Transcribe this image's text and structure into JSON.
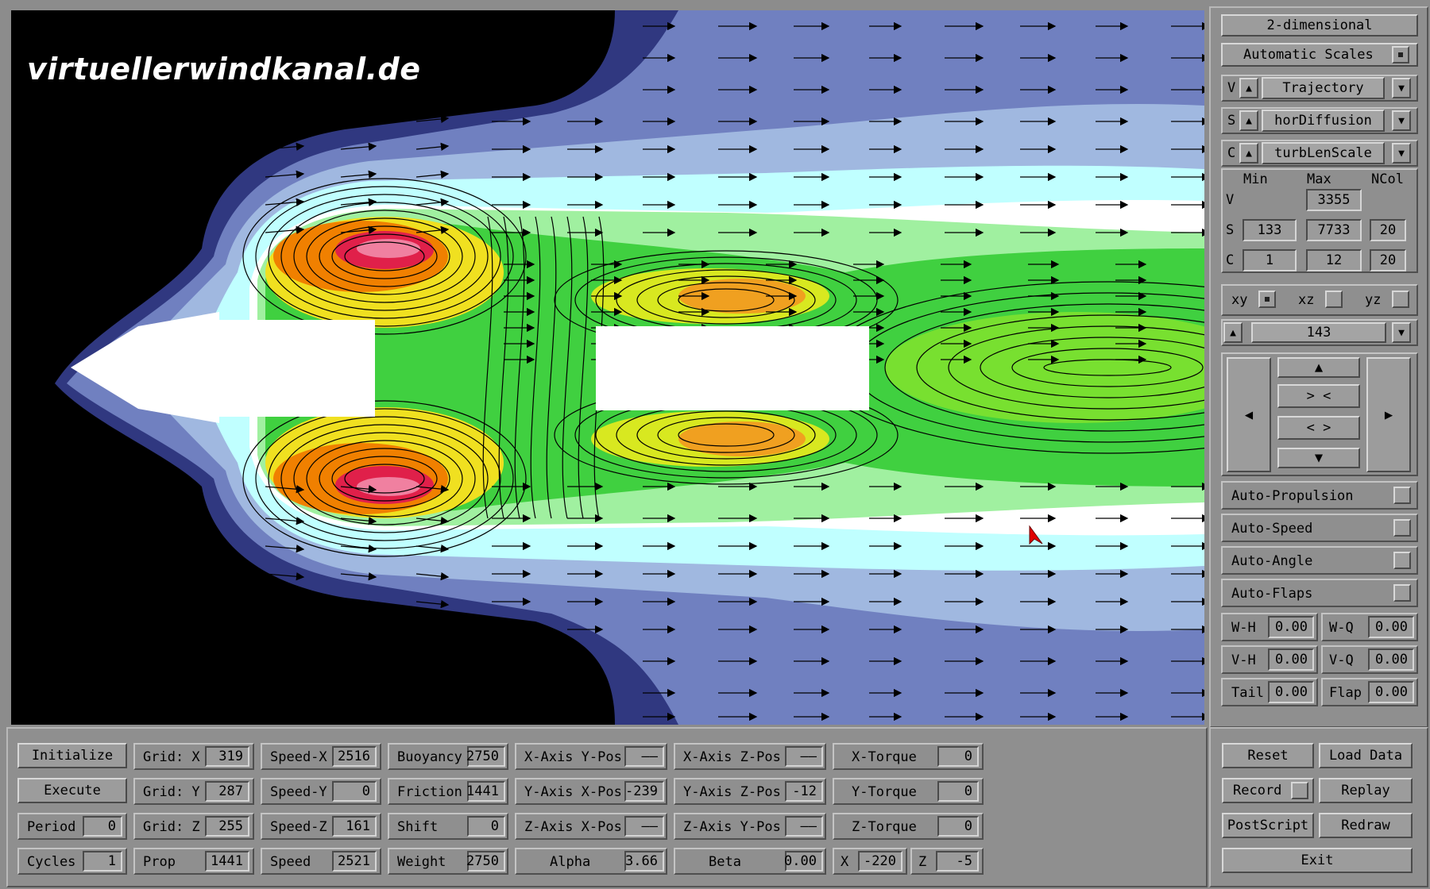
{
  "watermark": "virtuellerwindkanal.de",
  "colors": {
    "panel": "#8f8f8f",
    "red": "#e0204a",
    "orange": "#f08000",
    "yellow": "#f0e020",
    "green": "#40d040",
    "lightgreen": "#a0f0a0",
    "cyan": "#c0ffff",
    "lightblue": "#a0b8e0",
    "blue": "#7080c0",
    "navy": "#303880"
  },
  "side": {
    "mode": "2-dimensional",
    "automatic_scales": "Automatic Scales",
    "rows": [
      {
        "letter": "V",
        "value": "Trajectory"
      },
      {
        "letter": "S",
        "value": "horDiffusion"
      },
      {
        "letter": "C",
        "value": "turbLenScale"
      }
    ],
    "headers": {
      "min": "Min",
      "max": "Max",
      "ncol": "NCol"
    },
    "scales": [
      {
        "letter": "V",
        "min": "",
        "max": "3355",
        "ncol": ""
      },
      {
        "letter": "S",
        "min": "133",
        "max": "7733",
        "ncol": "20"
      },
      {
        "letter": "C",
        "min": "1",
        "max": "12",
        "ncol": "20"
      }
    ],
    "planes": [
      "xy",
      "xz",
      "yz"
    ],
    "slice": "143",
    "nav": {
      "up": "▲",
      "down": "▼",
      "left": "◀",
      "right": "▶",
      "zoom_in": "> <",
      "zoom_out": "< >"
    },
    "autos": [
      "Auto-Propulsion",
      "Auto-Speed",
      "Auto-Angle",
      "Auto-Flaps"
    ],
    "params": [
      {
        "l1": "W-H",
        "v1": "0.00",
        "l2": "W-Q",
        "v2": "0.00"
      },
      {
        "l1": "V-H",
        "v1": "0.00",
        "l2": "V-Q",
        "v2": "0.00"
      },
      {
        "l1": "Tail",
        "v1": "0.00",
        "l2": "Flap",
        "v2": "0.00"
      }
    ]
  },
  "bottom": {
    "buttons": [
      "Initialize",
      "Execute"
    ],
    "period": {
      "label": "Period",
      "value": "0"
    },
    "cycles": {
      "label": "Cycles",
      "value": "1"
    },
    "grid": [
      {
        "label": "Grid: X",
        "value": "319"
      },
      {
        "label": "Grid: Y",
        "value": "287"
      },
      {
        "label": "Grid: Z",
        "value": "255"
      },
      {
        "label": "Prop",
        "value": "1441"
      }
    ],
    "speed": [
      {
        "label": "Speed-X",
        "value": "2516"
      },
      {
        "label": "Speed-Y",
        "value": "0"
      },
      {
        "label": "Speed-Z",
        "value": "161"
      },
      {
        "label": "Speed",
        "value": "2521"
      }
    ],
    "forces": [
      {
        "label": "Buoyancy",
        "value": "2750"
      },
      {
        "label": "Friction",
        "value": "1441"
      },
      {
        "label": "Shift",
        "value": "0"
      },
      {
        "label": "Weight",
        "value": "2750"
      }
    ],
    "axes1": [
      {
        "label": "X-Axis Y-Pos",
        "value": "——"
      },
      {
        "label": "Y-Axis X-Pos",
        "value": "-239"
      },
      {
        "label": "Z-Axis X-Pos",
        "value": "——"
      },
      {
        "label": "Alpha",
        "value": "3.66"
      }
    ],
    "axes2": [
      {
        "label": "X-Axis Z-Pos",
        "value": "——"
      },
      {
        "label": "Y-Axis Z-Pos",
        "value": "-12"
      },
      {
        "label": "Z-Axis Y-Pos",
        "value": "——"
      },
      {
        "label": "Beta",
        "value": "0.00"
      }
    ],
    "torque": [
      {
        "label": "X-Torque",
        "value": "0"
      },
      {
        "label": "Y-Torque",
        "value": "0"
      },
      {
        "label": "Z-Torque",
        "value": "0"
      }
    ],
    "xz": {
      "x_label": "X",
      "x_value": "-220",
      "z_label": "Z",
      "z_value": "-5"
    },
    "actions": [
      "Reset",
      "Load Data",
      "Record",
      "Replay",
      "PostScript",
      "Redraw",
      "Exit"
    ]
  }
}
